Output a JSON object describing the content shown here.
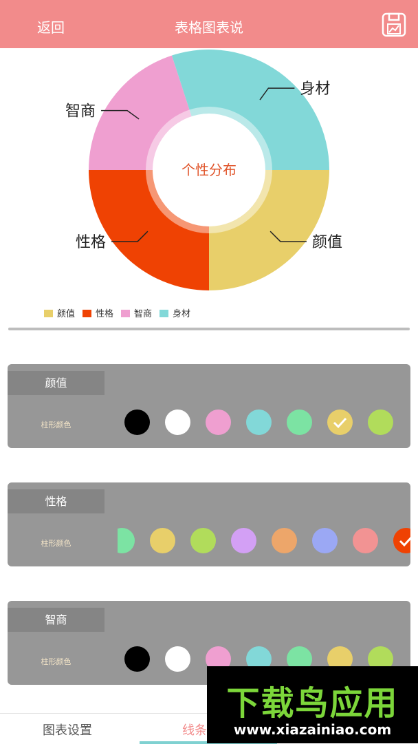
{
  "header": {
    "back_label": "返回",
    "title": "表格图表说",
    "bg_color": "#f28b8b"
  },
  "chart_data": {
    "type": "pie",
    "center_label": "个性分布",
    "categories": [
      "颜值",
      "性格",
      "智商",
      "身材"
    ],
    "values": [
      25,
      25,
      20,
      30
    ],
    "colors": [
      "#e8cf6a",
      "#ef4203",
      "#ef9fd0",
      "#82d8d8"
    ],
    "legend": {
      "placement": "bottom-left",
      "entries": [
        "颜值",
        "性格",
        "智商",
        "身材"
      ]
    }
  },
  "panels": [
    {
      "title": "颜值",
      "label": "柱形颜色",
      "swatches": [
        "#000000",
        "#ffffff",
        "#ef9fd0",
        "#82d8d8",
        "#7ce3a3",
        "#e8cf6a",
        "#b1dc5b"
      ],
      "selected": 5,
      "offset": 0
    },
    {
      "title": "性格",
      "label": "柱形颜色",
      "swatches": [
        "#7ce3a3",
        "#e8cf6a",
        "#b1dc5b",
        "#d3a0f5",
        "#eda66a",
        "#9ba8f4",
        "#f29393",
        "#ef4203"
      ],
      "selected": 7,
      "offset": -22
    },
    {
      "title": "智商",
      "label": "柱形颜色",
      "swatches": [
        "#000000",
        "#ffffff",
        "#ef9fd0",
        "#82d8d8",
        "#7ce3a3",
        "#e8cf6a",
        "#b1dc5b"
      ],
      "selected": -1,
      "offset": 0
    }
  ],
  "tabs": [
    {
      "label": "图表设置"
    },
    {
      "label": "线条"
    }
  ],
  "active_tab": 1,
  "watermark": {
    "logo_text": "下载鸟应用",
    "url": "www.xiazainiao.com"
  }
}
